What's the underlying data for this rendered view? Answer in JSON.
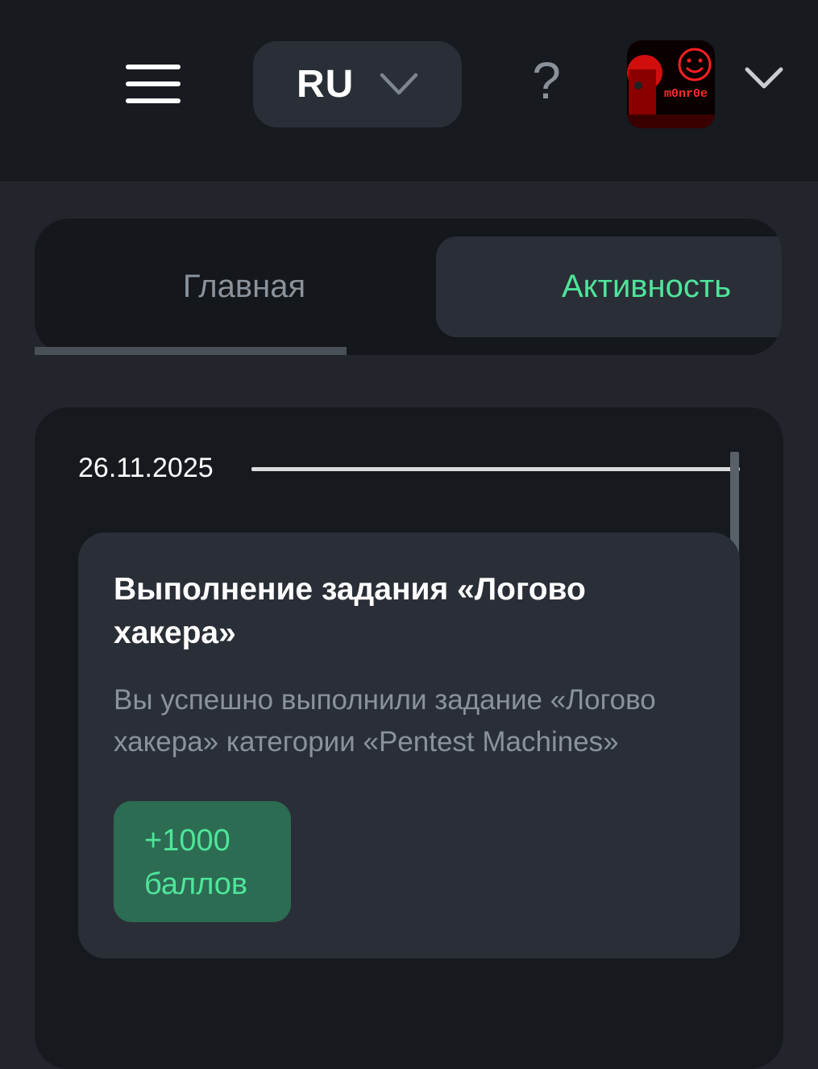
{
  "header": {
    "language": "RU",
    "help_label": "?",
    "avatar_text": "m0nr0e"
  },
  "tabs": [
    {
      "label": "Главная",
      "active": false
    },
    {
      "label": "Активность",
      "active": true
    }
  ],
  "activity": {
    "date": "26.11.2025",
    "events": [
      {
        "title": "Выполнение задания «Логово хакера»",
        "description": "Вы успешно выполнили задание «Логово хакера» категории «Pentest Machines»",
        "points_value": "+1000",
        "points_unit": "баллов"
      }
    ]
  },
  "colors": {
    "accent": "#4ee59a",
    "header_bg": "#171a1f",
    "page_bg": "#22262c",
    "card_bg": "#2a2f37",
    "badge_bg": "#2c6c52"
  },
  "icons": {
    "menu": "hamburger-icon",
    "language_chevron": "chevron-down-icon",
    "help": "question-icon",
    "account_chevron": "chevron-down-icon"
  }
}
